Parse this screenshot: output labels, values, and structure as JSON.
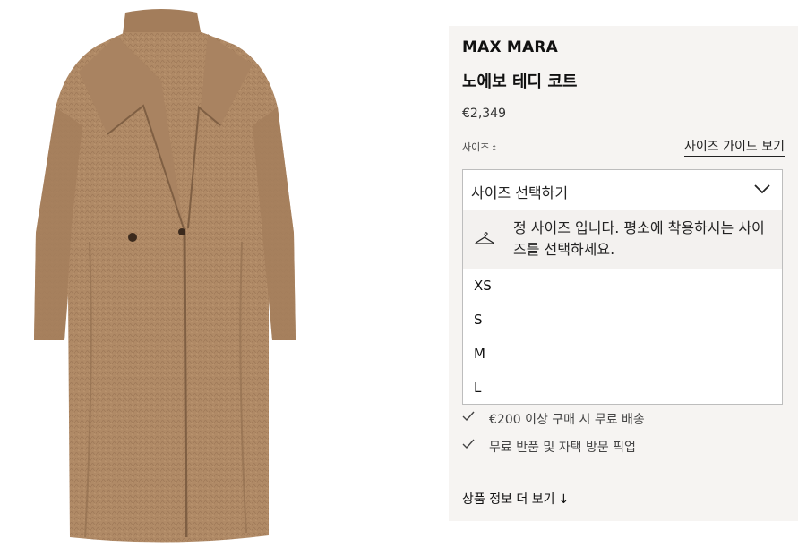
{
  "product": {
    "brand": "MAX MARA",
    "title": "노에보 테디 코트",
    "price": "€2,349",
    "image_icon": "teddy-coat-photo"
  },
  "size": {
    "label": "사이즈",
    "sort_glyph": "↕",
    "guide_link": "사이즈 가이드 보기",
    "placeholder": "사이즈 선택하기",
    "fit_note": "정 사이즈 입니다. 평소에 착용하시는 사이즈를 선택하세요.",
    "options": [
      "XS",
      "S",
      "M",
      "L"
    ]
  },
  "perks": [
    "€200 이상 구매 시 무료 배송",
    "무료 반품 및 자택 방문 픽업"
  ],
  "more_info": {
    "label": "상품 정보 더 보기",
    "arrow": "↓"
  },
  "colors": {
    "panel_bg": "#f6f4f2",
    "coat": "#b08a66",
    "coat_shadow": "#8f6c4d"
  }
}
